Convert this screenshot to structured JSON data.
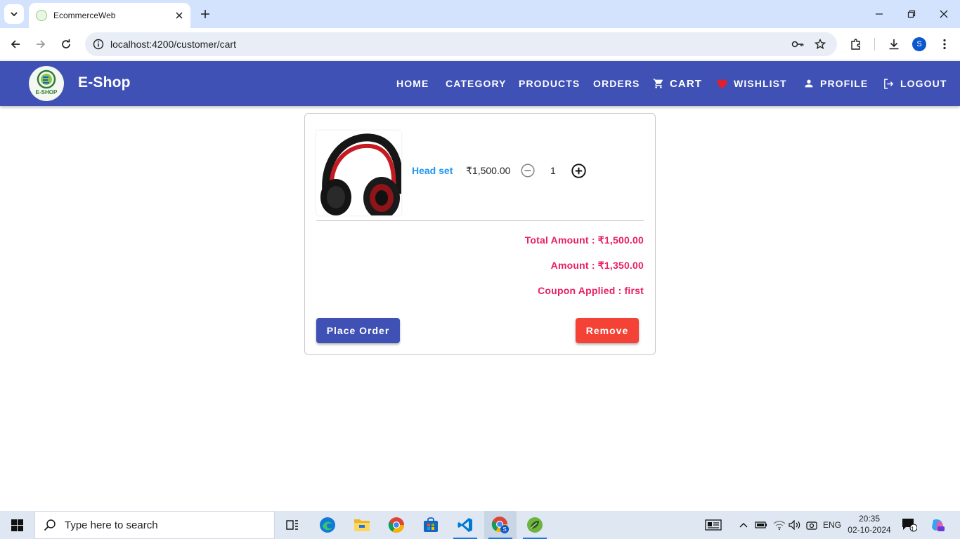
{
  "browser": {
    "tab_title": "EcommerceWeb",
    "url": "localhost:4200/customer/cart",
    "profile_initial": "S"
  },
  "navbar": {
    "brand": "E-Shop",
    "logo_text": "E-SHOP",
    "items": [
      {
        "label": "HOME",
        "icon": ""
      },
      {
        "label": "CATEGORY",
        "icon": ""
      },
      {
        "label": "PRODUCTS",
        "icon": ""
      },
      {
        "label": "ORDERS",
        "icon": ""
      },
      {
        "label": "CART",
        "icon": "shopping-cart-icon"
      },
      {
        "label": "WISHLIST",
        "icon": "heart-icon"
      },
      {
        "label": "PROFILE",
        "icon": "person-icon"
      },
      {
        "label": "LOGOUT",
        "icon": "logout-icon"
      }
    ]
  },
  "cart": {
    "item": {
      "name": "Head set",
      "price": "₹1,500.00",
      "quantity": "1"
    },
    "total_amount": "Total Amount : ₹1,500.00",
    "amount": "Amount : ₹1,350.00",
    "coupon": "Coupon Applied : first",
    "place_order_label": "Place Order",
    "remove_label": "Remove"
  },
  "taskbar": {
    "search_placeholder": "Type here to search",
    "language": "ENG",
    "time": "20:35",
    "date": "02-10-2024",
    "notification_count": "1"
  },
  "colors": {
    "primary": "#3f51b5",
    "accent_pink": "#e91e63",
    "warn": "#f44336",
    "link_blue": "#2196f3"
  }
}
